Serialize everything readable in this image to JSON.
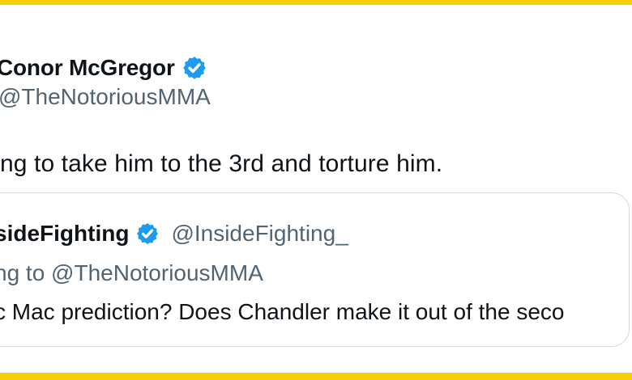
{
  "tweet": {
    "display_name": "Conor McGregor",
    "handle": "@TheNotoriousMMA",
    "text": "ng to take him to the 3rd and torture him.",
    "verified_icon": "verified-badge-icon"
  },
  "quoted_tweet": {
    "display_name": "sideFighting",
    "handle": "@InsideFighting_",
    "replying_to": "ng to @TheNotoriousMMA",
    "text": "c Mac prediction? Does Chandler make it out of the seco",
    "verified_icon": "verified-badge-icon"
  },
  "colors": {
    "frame": "#f5cf0a",
    "verified": "#1d9bf0",
    "primary_text": "#0f1419",
    "secondary_text": "#536471",
    "border": "#cfd9de"
  }
}
